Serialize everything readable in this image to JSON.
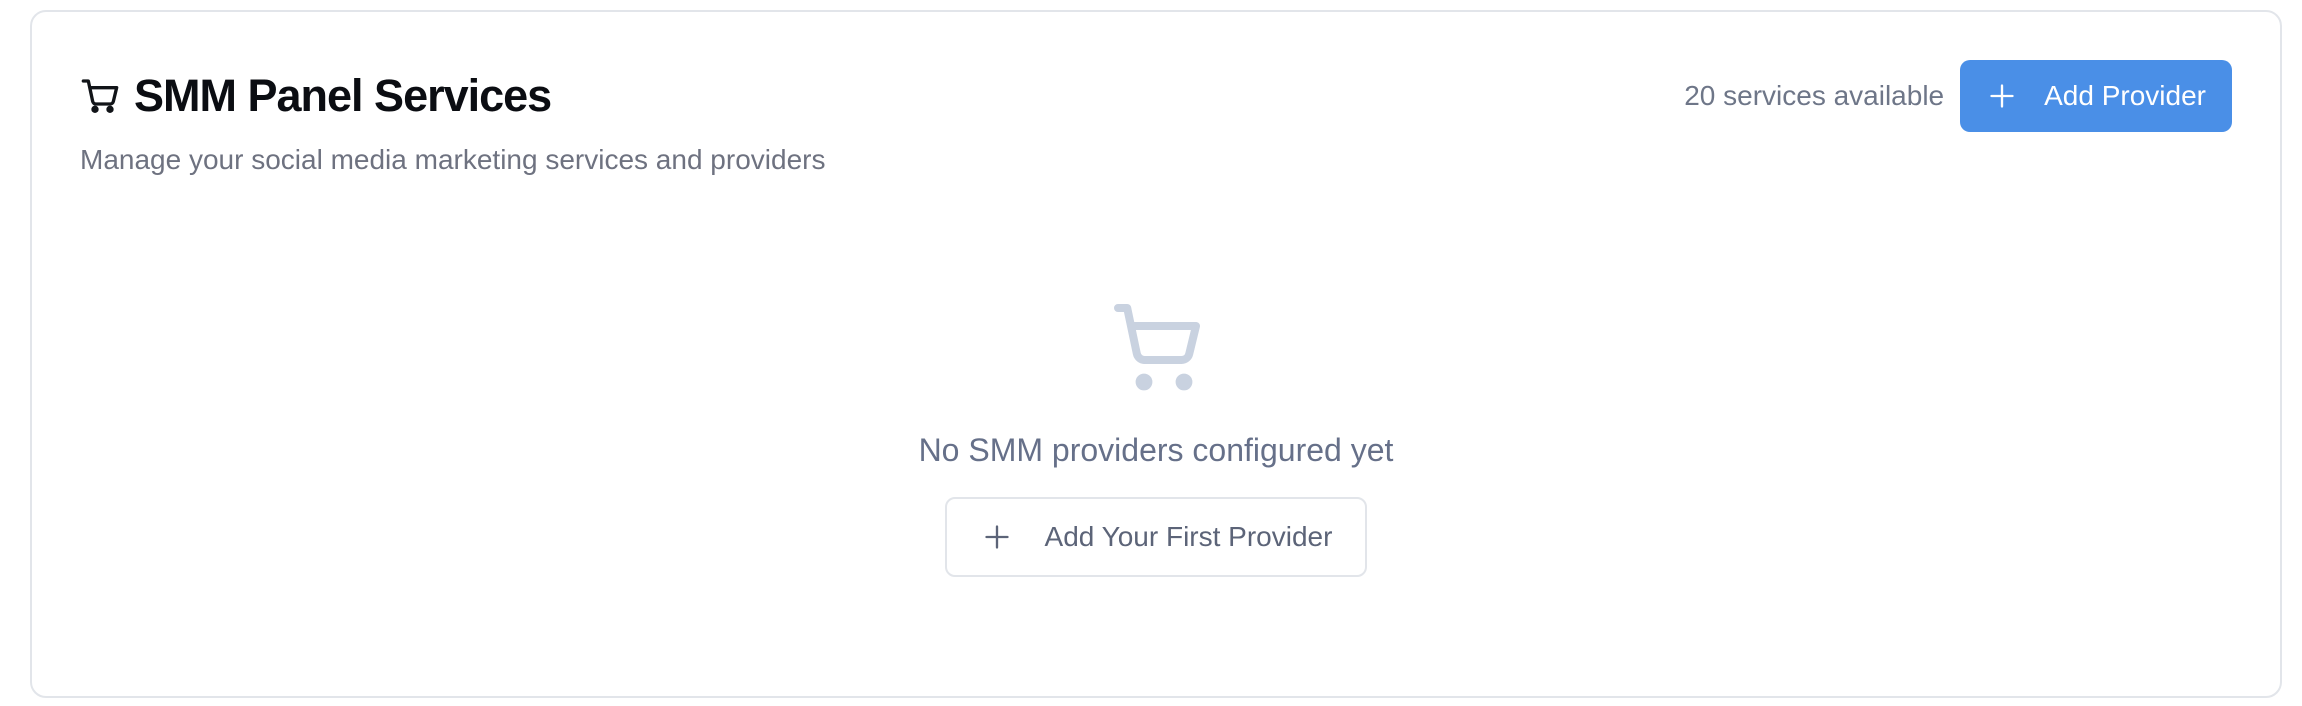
{
  "panel": {
    "title": "SMM Panel Services",
    "title_icon": "shopping-cart-icon",
    "subtitle": "Manage your social media marketing services and providers",
    "services_count_text": "20 services available",
    "add_provider_label": "Add Provider",
    "add_provider_icon": "plus-icon",
    "accent_color": "#4a8fe7"
  },
  "empty_state": {
    "icon": "shopping-cart-icon",
    "message": "No SMM providers configured yet",
    "add_first_label": "Add Your First Provider",
    "add_first_icon": "plus-icon",
    "icon_color": "#c9d2e0"
  }
}
